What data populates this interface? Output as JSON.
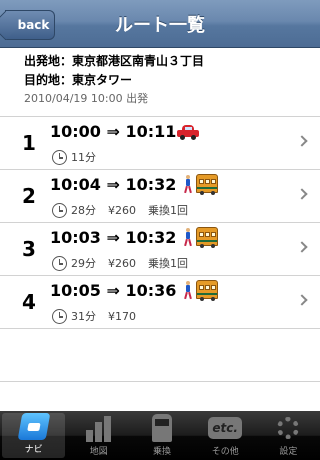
{
  "navbar": {
    "back_label": "back",
    "title": "ルート一覧"
  },
  "info": {
    "origin": "出発地：東京都港区南青山３丁目",
    "destination": "目的地：東京タワー",
    "departure": "2010/04/19 10:00 出発"
  },
  "routes": [
    {
      "num": "1",
      "time": "10:00 ⇒ 10:11",
      "duration": "11分",
      "fare": "",
      "transfers": "",
      "modes": [
        "car-icon"
      ]
    },
    {
      "num": "2",
      "time": "10:04 ⇒ 10:32",
      "duration": "28分",
      "fare": "¥260",
      "transfers": "乗換1回",
      "modes": [
        "walking-person-icon",
        "train-icon"
      ]
    },
    {
      "num": "3",
      "time": "10:03 ⇒ 10:32",
      "duration": "29分",
      "fare": "¥260",
      "transfers": "乗換1回",
      "modes": [
        "walking-person-icon",
        "train-icon"
      ]
    },
    {
      "num": "4",
      "time": "10:05 ⇒ 10:36",
      "duration": "31分",
      "fare": "¥170",
      "transfers": "",
      "modes": [
        "walking-person-icon",
        "train-icon"
      ]
    }
  ],
  "tabs": [
    {
      "label": "ナビ",
      "icon": "navi-icon",
      "active": true
    },
    {
      "label": "地図",
      "icon": "map-icon",
      "active": false
    },
    {
      "label": "乗換",
      "icon": "train-icon",
      "active": false
    },
    {
      "label": "その他",
      "icon": "etc-icon",
      "active": false
    },
    {
      "label": "設定",
      "icon": "gear-icon",
      "active": false
    }
  ],
  "colors": {
    "navbar": "#6a88ae",
    "car": "#d8242c",
    "train": "#e59a27",
    "tab_active": "#1a78d8"
  }
}
